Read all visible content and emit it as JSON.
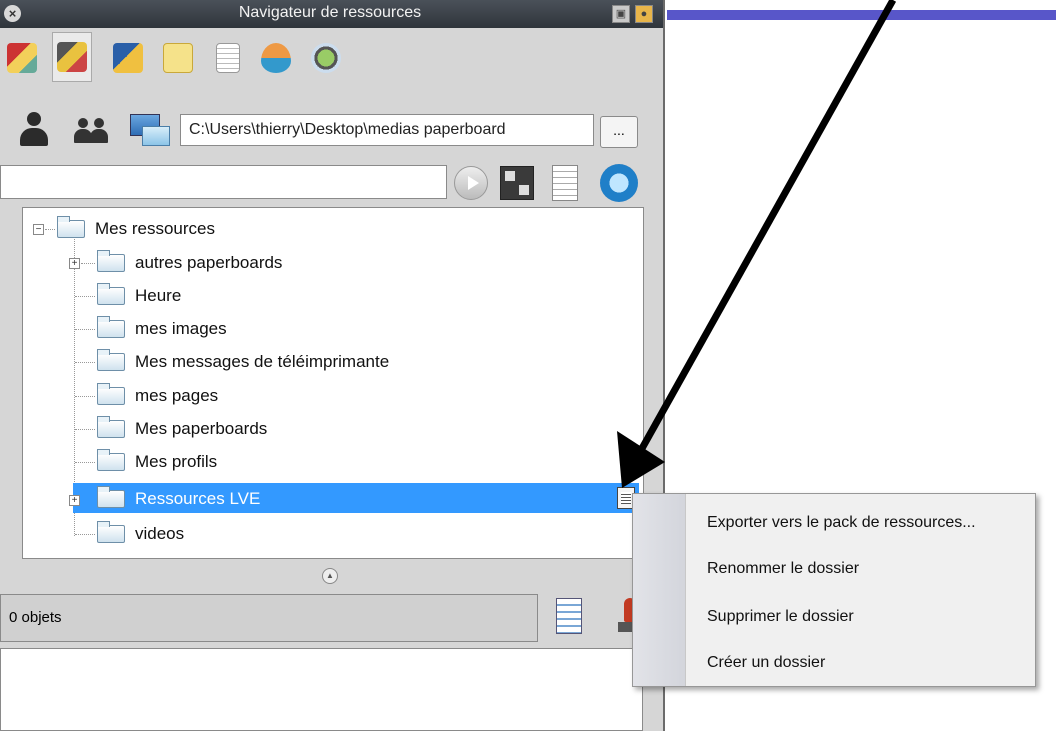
{
  "window": {
    "title": "Navigateur de ressources"
  },
  "toolbar": {
    "icons": [
      "themes-icon",
      "gallery-icon",
      "images-icon",
      "notes-icon",
      "page-icon",
      "spinning-top-icon",
      "lesson-icon"
    ]
  },
  "path_row": {
    "path_value": "C:\\Users\\thierry\\Desktop\\medias paperboard",
    "browse_label": "..."
  },
  "tree": {
    "root": "Mes ressources",
    "items": [
      {
        "label": "autres paperboards",
        "expandable": true
      },
      {
        "label": "Heure",
        "expandable": false
      },
      {
        "label": "mes images",
        "expandable": false
      },
      {
        "label": "Mes messages de téléimprimante",
        "expandable": false
      },
      {
        "label": "mes pages",
        "expandable": false
      },
      {
        "label": "Mes paperboards",
        "expandable": false
      },
      {
        "label": "Mes profils",
        "expandable": false
      },
      {
        "label": "Ressources LVE",
        "expandable": true,
        "selected": true
      },
      {
        "label": "videos",
        "expandable": false
      }
    ]
  },
  "status": {
    "objects_count": "0 objets"
  },
  "context_menu": {
    "items": [
      "Exporter vers le pack de ressources...",
      "Renommer le dossier",
      "Supprimer le dossier",
      "Créer un dossier"
    ]
  },
  "colors": {
    "selection": "#3399ff",
    "accent_bar": "#5856c9",
    "titlebar": "#3a4047"
  }
}
